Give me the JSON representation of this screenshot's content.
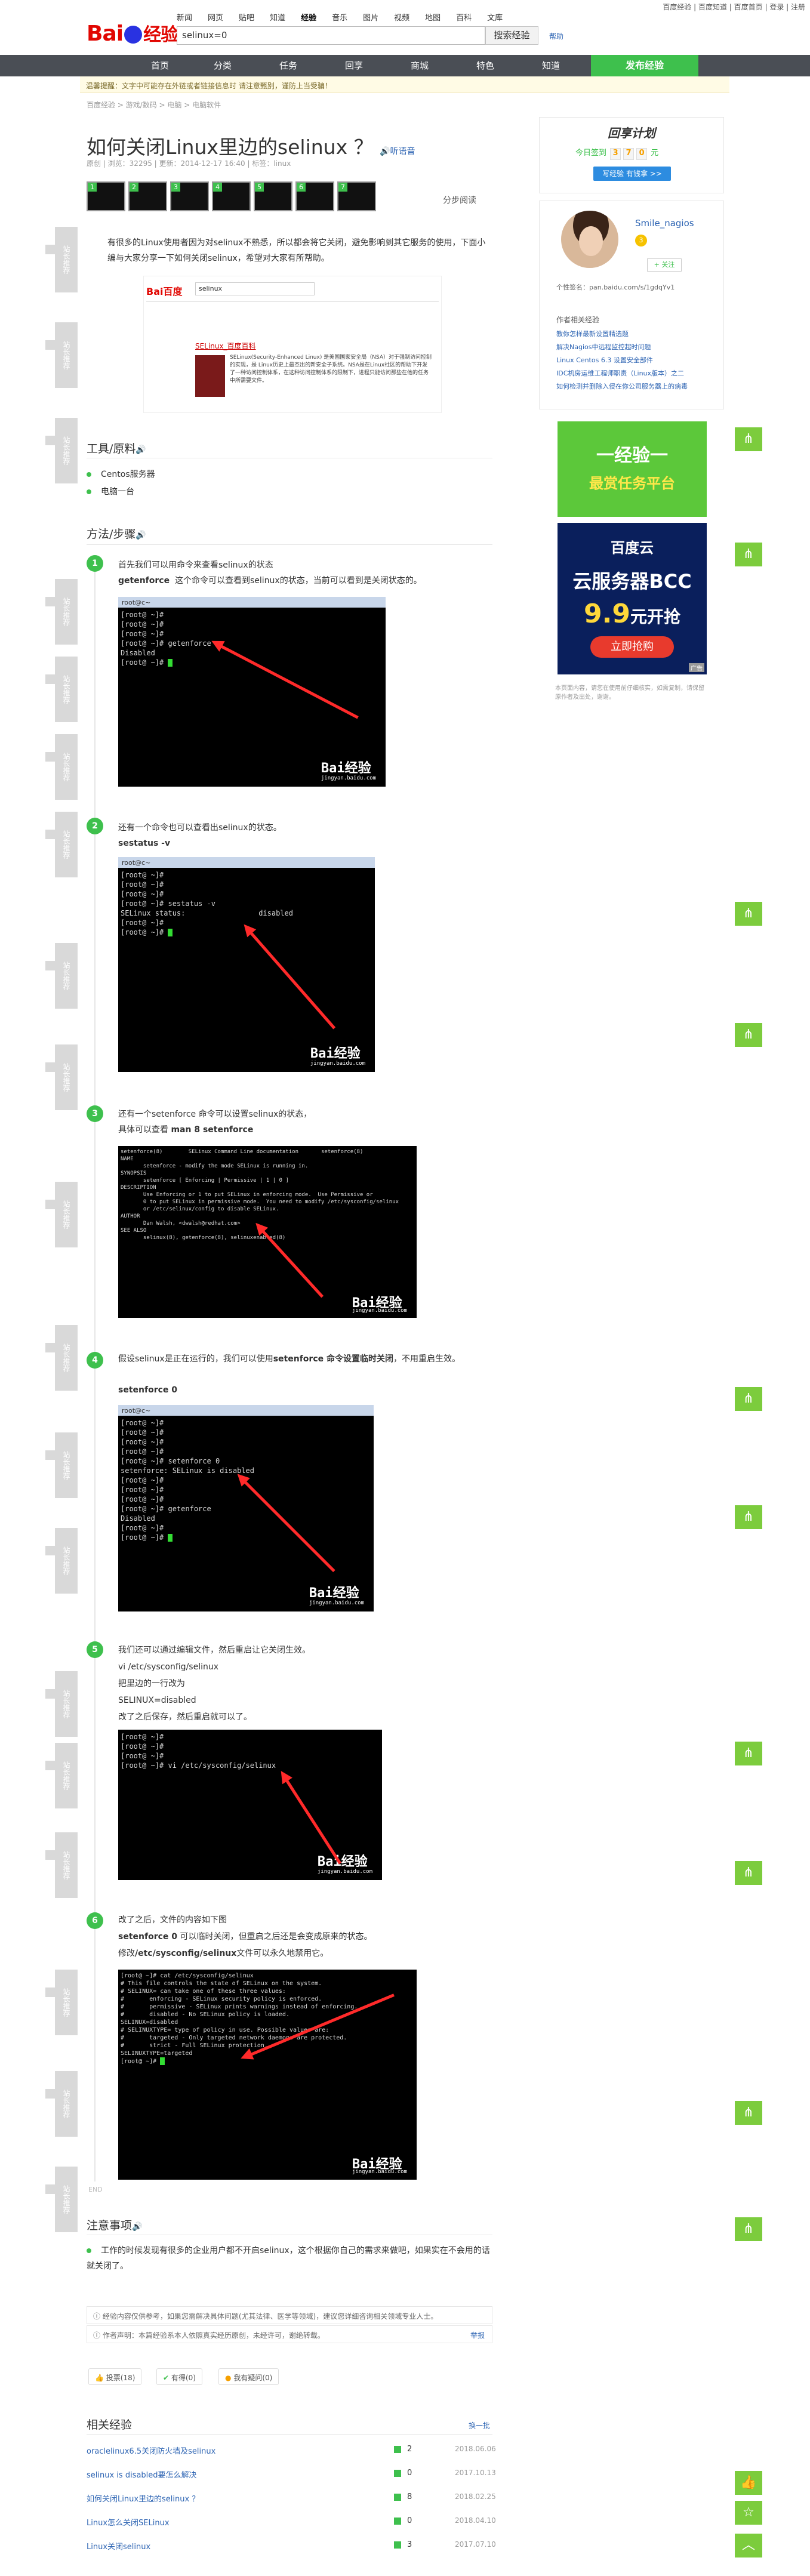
{
  "topbar": {
    "links": "百度经验 | 百度知道 | 百度首页 | 登录 | 注册"
  },
  "logo": {
    "text": "Bai",
    "suffix": "经验"
  },
  "nav_top": [
    "新闻",
    "网页",
    "贴吧",
    "知道",
    "经验",
    "音乐",
    "图片",
    "视频",
    "地图",
    "百科",
    "文库"
  ],
  "search": {
    "value": "selinux=0",
    "button": "搜索经验",
    "help": "帮助"
  },
  "main_nav": [
    "首页",
    "分类",
    "任务",
    "回享",
    "商城",
    "特色",
    "知道"
  ],
  "publish": "发布经验",
  "notice": "温馨提醒：文字中可能存在外链或者链接信息时 请注意甄别，谨防上当受骗！",
  "breadcrumb": "百度经验 > 游戏/数码 > 电脑 > 电脑软件",
  "article": {
    "title": "如何关闭Linux里边的selinux ？",
    "listen": "听语音",
    "meta": "原创 | 浏览：32295 | 更新：2014-12-17 16:40 | 标签：linux",
    "step_read": "分步阅读",
    "thumbs": [
      "1",
      "2",
      "3",
      "4",
      "5",
      "6",
      "7"
    ],
    "intro": "有很多的Linux使用者因为对selinux不熟悉，所以都会将它关闭，避免影响到其它服务的使用，下面小编与大家分享一下如何关闭selinux，希望对大家有所帮助。",
    "baike": {
      "search_value": "selinux",
      "link_title": "SELinux_百度百科",
      "desc": "SELinux(Security-Enhanced Linux) 是美国国家安全局（NSA）对于强制访问控制的实现，是 Linux历史上最杰出的新安全子系统。NSA是在Linux社区的帮助下开发了一种访问控制体系，在这种访问控制体系的限制下，进程只能访问那些在他的任务中所需要文件。"
    },
    "tools_title": "工具/原料",
    "tools": [
      "Centos服务器",
      "电脑一台"
    ],
    "method_title": "方法/步骤",
    "steps": [
      {
        "num": "1",
        "text": "首先我们可以用命令来查看selinux的状态",
        "cmd": "getenforce",
        "cmd_note": "这个命令可以查看到selinux的状态，当前可以看到是关闭状态的。"
      },
      {
        "num": "2",
        "text": "还有一个命令也可以查看出selinux的状态。",
        "cmd": "sestatus -v"
      },
      {
        "num": "3",
        "text": "还有一个setenforce 命令可以设置selinux的状态，",
        "text2": "具体可以查看",
        "cmd": "man 8 setenforce"
      },
      {
        "num": "4",
        "text": "假设selinux是正在运行的，我们可以使用",
        "bold": "setenforce 命令设置临时关闭",
        "text_tail": "，不用重启生效。",
        "cmd": "setenforce 0"
      },
      {
        "num": "5",
        "lines": [
          "我们还可以通过编辑文件，然后重启让它关闭生效。",
          "vi /etc/sysconfig/selinux",
          "把里边的一行改为",
          "SELINUX=disabled",
          "改了之后保存，然后重启就可以了。"
        ]
      },
      {
        "num": "6",
        "text": "改了之后，文件的内容如下图",
        "cmd": "setenforce 0",
        "cmd_note": "可以临时关闭，但重启之后还是会变成原来的状态。",
        "text3": "修改",
        "cmd2": "/etc/sysconfig/selinux",
        "text3_tail": "文件可以永久地禁用它。"
      }
    ],
    "end": "END",
    "notes_title": "注意事项",
    "notes": [
      "工作的时候发现有很多的企业用户都不开启selinux，这个根据你自己的需求来做吧，如果实在不会用的话就关闭了。"
    ],
    "tip1": "经验内容仅供参考，如果您需解决具体问题(尤其法律、医学等领域)，建议您详细咨询相关领域专业人士。",
    "tip2": "作者声明：本篇经验系本人依照真实经历原创，未经许可，谢绝转载。",
    "report": "举报",
    "votes": [
      "投票(18)",
      "有得(0)",
      "我有疑问(0)"
    ]
  },
  "terminals": [
    {
      "title": "root@c~",
      "lines": [
        "[root@ ~]#",
        "[root@ ~]#",
        "[root@ ~]#",
        "[root@ ~]# getenforce",
        "Disabled",
        "[root@ ~]# "
      ]
    },
    {
      "title": "root@c~",
      "lines": [
        "[root@ ~]#",
        "[root@ ~]#",
        "[root@ ~]#",
        "[root@ ~]# sestatus -v",
        "SELinux status:                 disabled",
        "[root@ ~]#",
        "[root@ ~]# "
      ]
    },
    {
      "title": "",
      "lines": [
        "setenforce(8)        SELinux Command Line documentation       setenforce(8)",
        "",
        "NAME",
        "       setenforce - modify the mode SELinux is running in.",
        "",
        "SYNOPSIS",
        "       setenforce [ Enforcing | Permissive | 1 | 0 ]",
        "",
        "DESCRIPTION",
        "       Use Enforcing or 1 to put SELinux in enforcing mode.  Use Permissive or",
        "       0 to put SELinux in permissive mode.  You need to modify /etc/sysconfig/selinux",
        "       or /etc/selinux/config to disable SELinux.",
        "",
        "AUTHOR",
        "       Dan Walsh, <dwalsh@redhat.com>",
        "",
        "SEE ALSO",
        "       selinux(8), getenforce(8), selinuxenabled(8)"
      ]
    },
    {
      "title": "root@c~",
      "lines": [
        "[root@ ~]#",
        "[root@ ~]#",
        "[root@ ~]#",
        "[root@ ~]#",
        "[root@ ~]# setenforce 0",
        "setenforce: SELinux is disabled",
        "[root@ ~]#",
        "[root@ ~]#",
        "[root@ ~]#",
        "[root@ ~]# getenforce",
        "Disabled",
        "[root@ ~]#",
        "[root@ ~]# "
      ]
    },
    {
      "title": "",
      "lines": [
        "[root@ ~]#",
        "[root@ ~]#",
        "[root@ ~]#",
        "[root@ ~]# vi /etc/sysconfig/selinux "
      ]
    },
    {
      "title": "",
      "lines": [
        "[root@ ~]# cat /etc/sysconfig/selinux",
        "# This file controls the state of SELinux on the system.",
        "# SELINUX= can take one of these three values:",
        "#       enforcing - SELinux security policy is enforced.",
        "#       permissive - SELinux prints warnings instead of enforcing.",
        "#       disabled - No SELinux policy is loaded.",
        "SELINUX=disabled",
        "# SELINUXTYPE= type of policy in use. Possible values are:",
        "#       targeted - Only targeted network daemons are protected.",
        "#       strict - Full SELinux protection.",
        "SELINUXTYPE=targeted",
        "",
        "[root@ ~]# "
      ]
    }
  ],
  "watermark": {
    "text": "Bai经验",
    "sub": "jingyan.baidu.com"
  },
  "sidebar": {
    "checkin_title": "回享计划",
    "checkin_label": "今日签到",
    "checkin_digits": [
      "3",
      "7",
      "0"
    ],
    "checkin_unit": "元",
    "checkin_button": "写经验 有钱拿 >>",
    "author": "Smile_nagios",
    "author_level": "3",
    "follow": "+ 关注",
    "homepage": "个性签名：pan.baidu.com/s/1gdqYv1",
    "author_section": "作者相关经验",
    "author_links": [
      "教你怎样最新设置精选题",
      "解决Nagios中远程监控超时问题",
      "Linux Centos 6.3 设置安全部件",
      "IDC机房运维工程师职责（Linux版本）之二",
      "如何检测并删除入侵在你公司服务器上的病毒"
    ],
    "banner1_line1": "一经验一",
    "banner1_line2": "最赏任务平台",
    "banner2_brand": "百度云",
    "banner2_line": "云服务器BCC",
    "banner2_price": "9.9",
    "banner2_unit": "元开抢",
    "banner2_btn": "立即抢购",
    "banner2_ad": "广告",
    "footnote": "本页面内容，请您在使用前仔细核实，如需复制，请保留原作者及出处，谢谢。"
  },
  "related": {
    "title": "相关经验",
    "more": "换一批",
    "items": [
      {
        "title": "oraclelinux6.5关闭防火墙及selinux",
        "votes": "2",
        "date": "2018.06.06"
      },
      {
        "title": "selinux is disabled要怎么解决",
        "votes": "0",
        "date": "2017.10.13"
      },
      {
        "title": "如何关闭Linux里边的selinux ？",
        "votes": "8",
        "date": "2018.02.25"
      },
      {
        "title": "Linux怎么关闭SELinux",
        "votes": "0",
        "date": "2018.04.10"
      },
      {
        "title": "Linux关闭selinux",
        "votes": "3",
        "date": "2017.07.10"
      }
    ]
  },
  "float_icons": [
    "share",
    "like",
    "star",
    "top"
  ],
  "side_tag": "站长推荐",
  "colors": {
    "green": "#3ec04d",
    "navbar": "#4a4e55",
    "link": "#2d64b3"
  }
}
